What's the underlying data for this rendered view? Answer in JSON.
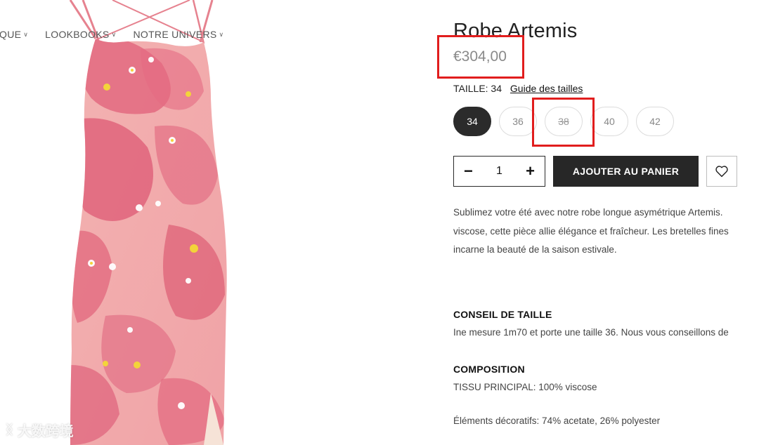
{
  "nav": {
    "items": [
      {
        "label": "TIQUE"
      },
      {
        "label": "LOOKBOOKS"
      },
      {
        "label": "NOTRE UNIVERS"
      }
    ]
  },
  "product": {
    "title": "Robe Artemis",
    "price": "€304,00",
    "size_label": "TAILLE: 34",
    "size_guide": "Guide des tailles",
    "sizes": [
      {
        "label": "34",
        "state": "selected"
      },
      {
        "label": "36",
        "state": "available"
      },
      {
        "label": "38",
        "state": "unavailable"
      },
      {
        "label": "40",
        "state": "available"
      },
      {
        "label": "42",
        "state": "available"
      }
    ],
    "quantity": "1",
    "minus": "−",
    "plus": "+",
    "add_to_cart": "AJOUTER AU PANIER",
    "description": [
      "Sublimez votre été avec notre robe longue asymétrique Artemis.",
      "viscose, cette pièce allie élégance et fraîcheur. Les bretelles fines",
      "incarne la beauté de la saison estivale."
    ],
    "size_advice_title": "CONSEIL DE TAILLE",
    "size_advice_text": "Ine mesure 1m70 et porte une taille 36. Nous vous conseillons de",
    "composition_title": "COMPOSITION",
    "composition_main": "TISSU PRINCIPAL: 100% viscose",
    "composition_deco": "Éléments décoratifs: 74% acetate, 26% polyester"
  },
  "watermark": {
    "text": "大数跨境"
  },
  "colors": {
    "accent_dark": "#272727",
    "highlight_red": "#e11d1d",
    "dress_pink": "#e8788f",
    "dress_light": "#f4b8b8"
  }
}
